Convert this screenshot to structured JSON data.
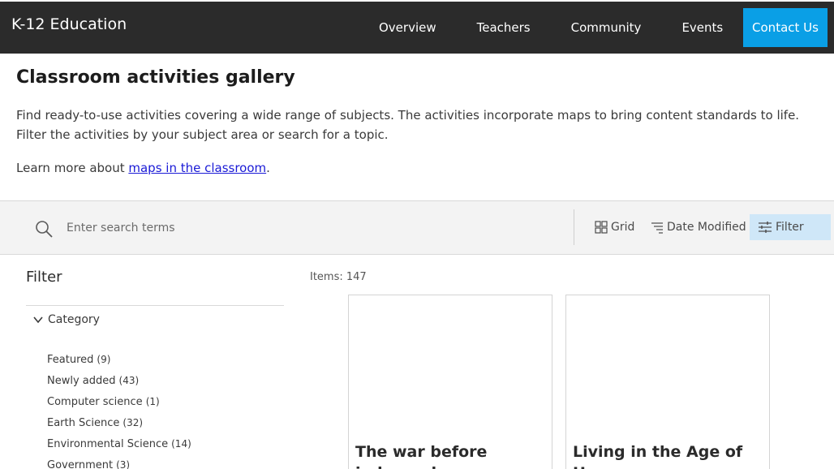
{
  "header": {
    "brand": "K-12 Education",
    "nav": [
      "Overview",
      "Teachers",
      "Community",
      "Events"
    ],
    "contact_label": "Contact Us"
  },
  "intro": {
    "title": "Classroom activities gallery",
    "description": "Find ready-to-use activities covering a wide range of subjects. The activities incorporate maps to bring content standards to life. Filter the activities by your subject area or search for a topic.",
    "learn_prefix": "Learn more about ",
    "learn_link": "maps in the classroom",
    "learn_suffix": "."
  },
  "toolbar": {
    "search_placeholder": "Enter search terms",
    "grid_label": "Grid",
    "sort_label": "Date Modified",
    "filter_label": "Filter"
  },
  "filter": {
    "title": "Filter",
    "category_label": "Category",
    "categories": [
      {
        "label": "Featured",
        "count": "(9)"
      },
      {
        "label": "Newly added",
        "count": "(43)"
      },
      {
        "label": "Computer science",
        "count": "(1)"
      },
      {
        "label": "Earth Science",
        "count": "(32)"
      },
      {
        "label": "Environmental Science",
        "count": "(14)"
      },
      {
        "label": "Government",
        "count": "(3)"
      }
    ]
  },
  "results": {
    "count_text": "Items: 147",
    "cards": [
      {
        "title": "The war before independence"
      },
      {
        "title": "Living in the Age of Humans"
      }
    ]
  },
  "colors": {
    "topbar": "#2b2b2b",
    "contact_button": "#0a9fe6",
    "filter_active": "#cfe7f8",
    "link": "#1a1ad6"
  }
}
